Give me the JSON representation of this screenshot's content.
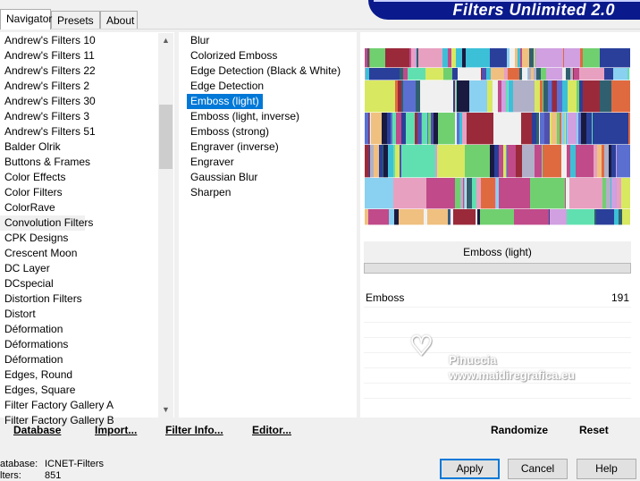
{
  "tabs": {
    "navigator": "Navigator",
    "presets": "Presets",
    "about": "About"
  },
  "banner": {
    "title": "Filters Unlimited 2.0"
  },
  "categories": [
    "Andrew's Filters 10",
    "Andrew's Filters 11",
    "Andrew's Filters 22",
    "Andrew's Filters 2",
    "Andrew's Filters 30",
    "Andrew's Filters 3",
    "Andrew's Filters 51",
    "Balder Olrik",
    "Buttons & Frames",
    "Color Effects",
    "Color Filters",
    "ColorRave",
    "Convolution Filters",
    "CPK Designs",
    "Crescent Moon",
    "DC Layer",
    "DCspecial",
    "Distortion Filters",
    "Distort",
    "Déformation",
    "Déformations",
    "Déformation",
    "Edges, Round",
    "Edges, Square",
    "Filter Factory Gallery A",
    "Filter Factory Gallery B"
  ],
  "selected_category": "Convolution Filters",
  "filters": [
    "Blur",
    "Colorized Emboss",
    "Edge Detection (Black & White)",
    "Edge Detection",
    "Emboss (light)",
    "Emboss (light, inverse)",
    "Emboss (strong)",
    "Engraver (inverse)",
    "Engraver",
    "Gaussian Blur",
    "Sharpen"
  ],
  "selected_filter": "Emboss (light)",
  "controls": {
    "filter_name": "Emboss (light)",
    "param_label": "Emboss",
    "param_value": "191"
  },
  "bottom": {
    "database": "Database",
    "import": "Import...",
    "filter_info": "Filter Info...",
    "editor": "Editor...",
    "randomize": "Randomize",
    "reset": "Reset"
  },
  "status": {
    "database_label": "atabase:",
    "database_value": "ICNET-Filters",
    "filters_label": "lters:",
    "filters_value": "851"
  },
  "buttons": {
    "apply": "Apply",
    "cancel": "Cancel",
    "help": "Help"
  },
  "watermark": {
    "line1": "Pinuccia",
    "line2": "www.maidiregrafica.eu"
  },
  "colors": {
    "accent": "#0078d7",
    "banner": "#0a1a8c"
  }
}
